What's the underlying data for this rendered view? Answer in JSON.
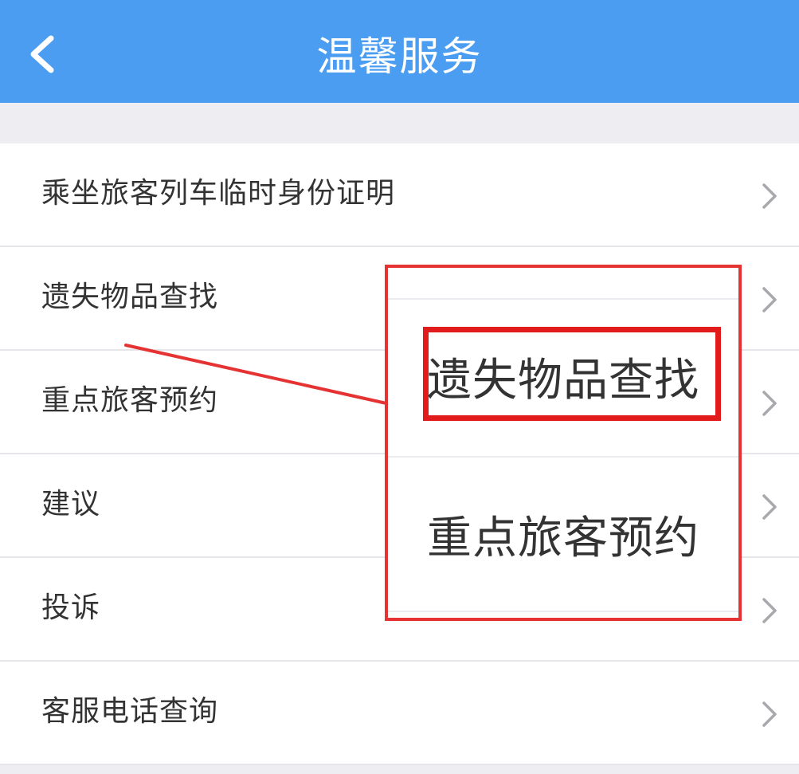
{
  "header": {
    "back_icon": "chevron-left-icon",
    "title": "温馨服务",
    "color": "#4a9df0"
  },
  "list": {
    "items": [
      {
        "label": "乘坐旅客列车临时身份证明"
      },
      {
        "label": "遗失物品查找"
      },
      {
        "label": "重点旅客预约"
      },
      {
        "label": "建议"
      },
      {
        "label": "投诉"
      },
      {
        "label": "客服电话查询"
      }
    ],
    "chevron_icon": "chevron-right-icon"
  },
  "callout": {
    "highlighted": "遗失物品查找",
    "second": "重点旅客预约",
    "color": "#e53333"
  }
}
